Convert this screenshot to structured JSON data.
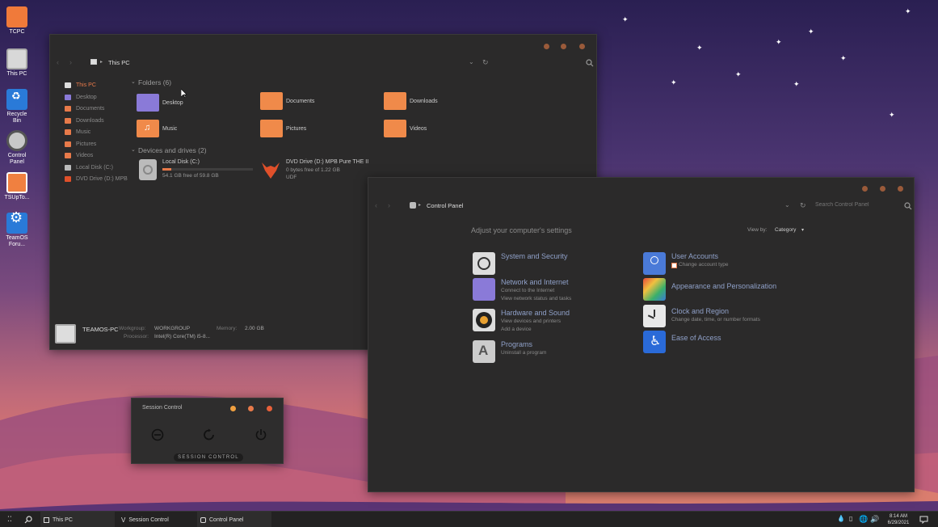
{
  "desktop": {
    "icons": [
      {
        "label": "TCPC"
      },
      {
        "label": "This PC"
      },
      {
        "label": "Recycle Bin"
      },
      {
        "label": "Control Panel"
      },
      {
        "label": "TSUpTo..."
      },
      {
        "label": "TeamOS Foru..."
      }
    ]
  },
  "explorer": {
    "breadcrumb": "This PC",
    "sidebar": [
      {
        "label": "This PC"
      },
      {
        "label": "Desktop"
      },
      {
        "label": "Documents"
      },
      {
        "label": "Downloads"
      },
      {
        "label": "Music"
      },
      {
        "label": "Pictures"
      },
      {
        "label": "Videos"
      },
      {
        "label": "Local Disk (C:)"
      },
      {
        "label": "DVD Drive (D:) MPB"
      }
    ],
    "folders_header": "Folders (6)",
    "folders": [
      {
        "label": "Desktop"
      },
      {
        "label": "Documents"
      },
      {
        "label": "Downloads"
      },
      {
        "label": "Music"
      },
      {
        "label": "Pictures"
      },
      {
        "label": "Videos"
      }
    ],
    "devices_header": "Devices and drives (2)",
    "drive_c": {
      "name": "Local Disk (C:)",
      "free": "54.1 GB free of 59.8 GB",
      "used_fraction": 0.1
    },
    "drive_d": {
      "name": "DVD Drive (D:) MPB Pure THE II",
      "free": "0 bytes free of 1.22 GB",
      "fs": "UDF"
    },
    "details": {
      "pc_name": "TEAMOS-PC",
      "workgroup_label": "Workgroup:",
      "workgroup": "WORKGROUP",
      "memory_label": "Memory:",
      "memory": "2.00 GB",
      "processor_label": "Processor:",
      "processor": "Intel(R) Core(TM) i5-8..."
    }
  },
  "control_panel": {
    "breadcrumb": "Control Panel",
    "search_placeholder": "Search Control Panel",
    "heading": "Adjust your computer's settings",
    "view_by_label": "View by:",
    "view_by_value": "Category",
    "categories_left": [
      {
        "title": "System and Security",
        "links": []
      },
      {
        "title": "Network and Internet",
        "links": [
          "Connect to the Internet",
          "View network status and tasks"
        ]
      },
      {
        "title": "Hardware and Sound",
        "links": [
          "View devices and printers",
          "Add a device"
        ]
      },
      {
        "title": "Programs",
        "links": [
          "Uninstall a program"
        ]
      }
    ],
    "categories_right": [
      {
        "title": "User Accounts",
        "links": [
          "Change account type"
        ]
      },
      {
        "title": "Appearance and Personalization",
        "links": []
      },
      {
        "title": "Clock and Region",
        "links": [
          "Change date, time, or number formats"
        ]
      },
      {
        "title": "Ease of Access",
        "links": []
      }
    ]
  },
  "session_control": {
    "title": "Session Control",
    "footer_label": "SESSION  CONTROL"
  },
  "taskbar": {
    "items": [
      {
        "label": "This PC"
      },
      {
        "label": "Session Control"
      },
      {
        "label": "Control Panel"
      }
    ],
    "time": "8:14 AM",
    "date": "6/29/2021"
  },
  "colors": {
    "accent": "#e87a4a",
    "window_bg": "#2b2a2a",
    "link_blue": "#8fa0c8"
  }
}
